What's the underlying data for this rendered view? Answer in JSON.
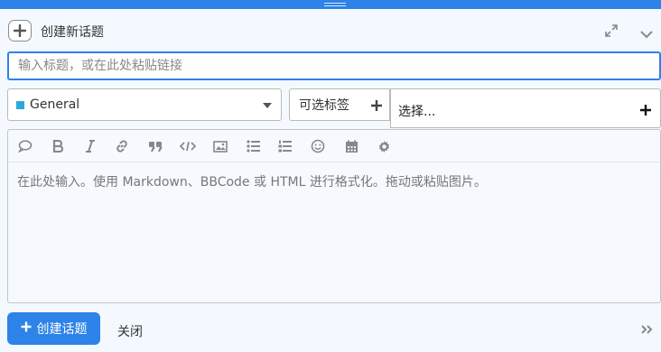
{
  "header": {
    "title": "创建新话题"
  },
  "title_input": {
    "value": "",
    "placeholder": "输入标题，或在此处粘贴链接"
  },
  "category": {
    "label": "General",
    "color": "#2da8dd"
  },
  "optional_tags": {
    "label": "可选标签"
  },
  "tag_chooser": {
    "label": "选择..."
  },
  "toolbar": {
    "icons": [
      "quote-bubble-icon",
      "bold-icon",
      "italic-icon",
      "link-icon",
      "blockquote-icon",
      "code-icon",
      "image-icon",
      "bullet-list-icon",
      "numbered-list-icon",
      "emoji-icon",
      "calendar-icon",
      "gear-icon"
    ]
  },
  "editor": {
    "placeholder": "在此处输入。使用 Markdown、BBCode 或 HTML 进行格式化。拖动或粘贴图片。"
  },
  "footer": {
    "create_label": "创建话题",
    "close_label": "关闭"
  },
  "colors": {
    "accent": "#2d83e8",
    "background": "#f4f9ff"
  }
}
